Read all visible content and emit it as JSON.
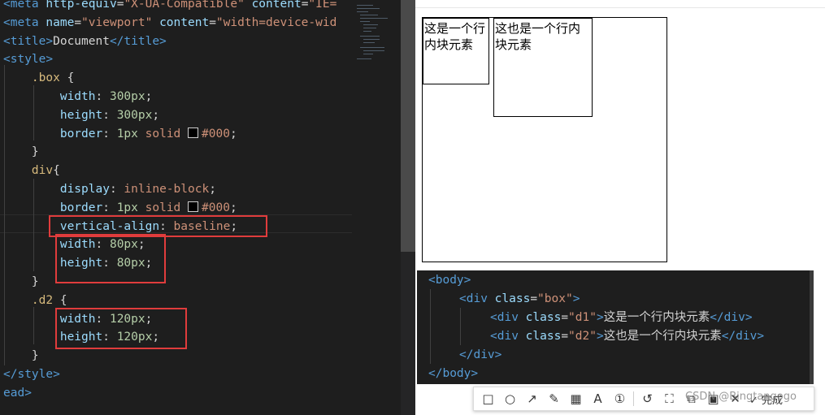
{
  "editor": {
    "lines": [
      [
        {
          "c": "t-tag",
          "t": "<meta "
        },
        {
          "c": "t-attr",
          "t": "http-equiv"
        },
        {
          "c": "t-punc",
          "t": "="
        },
        {
          "c": "t-str",
          "t": "\"X-UA-Compatible\" "
        },
        {
          "c": "t-attr",
          "t": "content"
        },
        {
          "c": "t-punc",
          "t": "="
        },
        {
          "c": "t-str",
          "t": "\"IE="
        }
      ],
      [
        {
          "c": "t-tag",
          "t": "<meta "
        },
        {
          "c": "t-attr",
          "t": "name"
        },
        {
          "c": "t-punc",
          "t": "="
        },
        {
          "c": "t-str",
          "t": "\"viewport\" "
        },
        {
          "c": "t-attr",
          "t": "content"
        },
        {
          "c": "t-punc",
          "t": "="
        },
        {
          "c": "t-str",
          "t": "\"width=device-wid"
        }
      ],
      [
        {
          "c": "t-tag",
          "t": "<title>"
        },
        {
          "c": "t-text",
          "t": "Document"
        },
        {
          "c": "t-tag",
          "t": "</title>"
        }
      ],
      [
        {
          "c": "t-tag",
          "t": "<style>"
        }
      ],
      [
        {
          "c": "t-punc",
          "t": "    "
        },
        {
          "c": "t-sel",
          "t": ".box"
        },
        {
          "c": "t-punc",
          "t": " {"
        }
      ],
      [
        {
          "c": "t-punc",
          "t": "        "
        },
        {
          "c": "t-prop",
          "t": "width"
        },
        {
          "c": "t-punc",
          "t": ": "
        },
        {
          "c": "t-val",
          "t": "300px"
        },
        {
          "c": "t-punc",
          "t": ";"
        }
      ],
      [
        {
          "c": "t-punc",
          "t": "        "
        },
        {
          "c": "t-prop",
          "t": "height"
        },
        {
          "c": "t-punc",
          "t": ": "
        },
        {
          "c": "t-val",
          "t": "300px"
        },
        {
          "c": "t-punc",
          "t": ";"
        }
      ],
      [
        {
          "c": "t-punc",
          "t": "        "
        },
        {
          "c": "t-prop",
          "t": "border"
        },
        {
          "c": "t-punc",
          "t": ": "
        },
        {
          "c": "t-val",
          "t": "1px"
        },
        {
          "c": "t-punc",
          "t": " "
        },
        {
          "c": "t-kw",
          "t": "solid "
        },
        {
          "c": "swatch",
          "t": ""
        },
        {
          "c": "t-kw",
          "t": "#000"
        },
        {
          "c": "t-punc",
          "t": ";"
        }
      ],
      [
        {
          "c": "t-punc",
          "t": "    }"
        }
      ],
      [
        {
          "c": "t-punc",
          "t": "    "
        },
        {
          "c": "t-sel",
          "t": "div"
        },
        {
          "c": "t-punc",
          "t": "{"
        }
      ],
      [
        {
          "c": "t-punc",
          "t": "        "
        },
        {
          "c": "t-prop",
          "t": "display"
        },
        {
          "c": "t-punc",
          "t": ": "
        },
        {
          "c": "t-kw",
          "t": "inline-block"
        },
        {
          "c": "t-punc",
          "t": ";"
        }
      ],
      [
        {
          "c": "t-punc",
          "t": "        "
        },
        {
          "c": "t-prop",
          "t": "border"
        },
        {
          "c": "t-punc",
          "t": ": "
        },
        {
          "c": "t-val",
          "t": "1px"
        },
        {
          "c": "t-punc",
          "t": " "
        },
        {
          "c": "t-kw",
          "t": "solid "
        },
        {
          "c": "swatch",
          "t": ""
        },
        {
          "c": "t-kw",
          "t": "#000"
        },
        {
          "c": "t-punc",
          "t": ";"
        }
      ],
      [
        {
          "c": "t-punc",
          "t": "        "
        },
        {
          "c": "t-prop",
          "t": "vertical-align"
        },
        {
          "c": "t-punc",
          "t": ": "
        },
        {
          "c": "t-kw",
          "t": "baseline"
        },
        {
          "c": "t-punc",
          "t": ";"
        }
      ],
      [
        {
          "c": "t-punc",
          "t": "        "
        },
        {
          "c": "t-prop",
          "t": "width"
        },
        {
          "c": "t-punc",
          "t": ": "
        },
        {
          "c": "t-val",
          "t": "80px"
        },
        {
          "c": "t-punc",
          "t": ";"
        }
      ],
      [
        {
          "c": "t-punc",
          "t": "        "
        },
        {
          "c": "t-prop",
          "t": "height"
        },
        {
          "c": "t-punc",
          "t": ": "
        },
        {
          "c": "t-val",
          "t": "80px"
        },
        {
          "c": "t-punc",
          "t": ";"
        }
      ],
      [
        {
          "c": "t-punc",
          "t": "    }"
        }
      ],
      [
        {
          "c": "t-punc",
          "t": "    "
        },
        {
          "c": "t-sel",
          "t": ".d2"
        },
        {
          "c": "t-punc",
          "t": " {"
        }
      ],
      [
        {
          "c": "t-punc",
          "t": "        "
        },
        {
          "c": "t-prop",
          "t": "width"
        },
        {
          "c": "t-punc",
          "t": ": "
        },
        {
          "c": "t-val",
          "t": "120px"
        },
        {
          "c": "t-punc",
          "t": ";"
        }
      ],
      [
        {
          "c": "t-punc",
          "t": "        "
        },
        {
          "c": "t-prop",
          "t": "height"
        },
        {
          "c": "t-punc",
          "t": ": "
        },
        {
          "c": "t-val",
          "t": "120px"
        },
        {
          "c": "t-punc",
          "t": ";"
        }
      ],
      [
        {
          "c": "t-punc",
          "t": "    }"
        }
      ],
      [
        {
          "c": "t-tag",
          "t": "</style>"
        }
      ],
      [
        {
          "c": "t-tag",
          "t": "ead>"
        }
      ]
    ]
  },
  "preview": {
    "d1_text": "这是一个行内块元素",
    "d2_text": "这也是一个行内块元素"
  },
  "snippet": {
    "lines": [
      [
        {
          "c": "t-tag",
          "t": "<body>"
        }
      ],
      [
        {
          "c": "t-tag",
          "t": "<div "
        },
        {
          "c": "t-attr",
          "t": "class"
        },
        {
          "c": "t-punc",
          "t": "="
        },
        {
          "c": "t-str",
          "t": "\"box\""
        },
        {
          "c": "t-tag",
          "t": ">"
        }
      ],
      [
        {
          "c": "t-tag",
          "t": "<div "
        },
        {
          "c": "t-attr",
          "t": "class"
        },
        {
          "c": "t-punc",
          "t": "="
        },
        {
          "c": "t-str",
          "t": "\"d1\""
        },
        {
          "c": "t-tag",
          "t": ">"
        },
        {
          "c": "t-text",
          "t": "这是一个行内块元素"
        },
        {
          "c": "t-tag",
          "t": "</div>"
        }
      ],
      [
        {
          "c": "t-tag",
          "t": "<div "
        },
        {
          "c": "t-attr",
          "t": "class"
        },
        {
          "c": "t-punc",
          "t": "="
        },
        {
          "c": "t-str",
          "t": "\"d2\""
        },
        {
          "c": "t-tag",
          "t": ">"
        },
        {
          "c": "t-text",
          "t": "这也是一个行内块元素"
        },
        {
          "c": "t-tag",
          "t": "</div>"
        }
      ],
      [
        {
          "c": "t-tag",
          "t": "</div>"
        }
      ],
      [
        {
          "c": "t-tag",
          "t": "</body>"
        }
      ]
    ]
  },
  "toolbar": {
    "tools": [
      {
        "name": "rectangle-tool-icon",
        "glyph": "□"
      },
      {
        "name": "ellipse-tool-icon",
        "glyph": "○"
      },
      {
        "name": "arrow-tool-icon",
        "glyph": "↗"
      },
      {
        "name": "pen-tool-icon",
        "glyph": "✎"
      },
      {
        "name": "mosaic-tool-icon",
        "glyph": "▦"
      },
      {
        "name": "text-tool-icon",
        "glyph": "A"
      },
      {
        "name": "number-tool-icon",
        "glyph": "①"
      },
      {
        "name": "undo-icon",
        "glyph": "↺"
      },
      {
        "name": "ocr-icon",
        "glyph": "⛶"
      },
      {
        "name": "pin-icon",
        "glyph": "⧉"
      },
      {
        "name": "save-icon",
        "glyph": "▣"
      },
      {
        "name": "close-icon",
        "glyph": "✕"
      }
    ],
    "done_label": "✓ 完成"
  },
  "watermark": "CSDN @Bingtangogo"
}
